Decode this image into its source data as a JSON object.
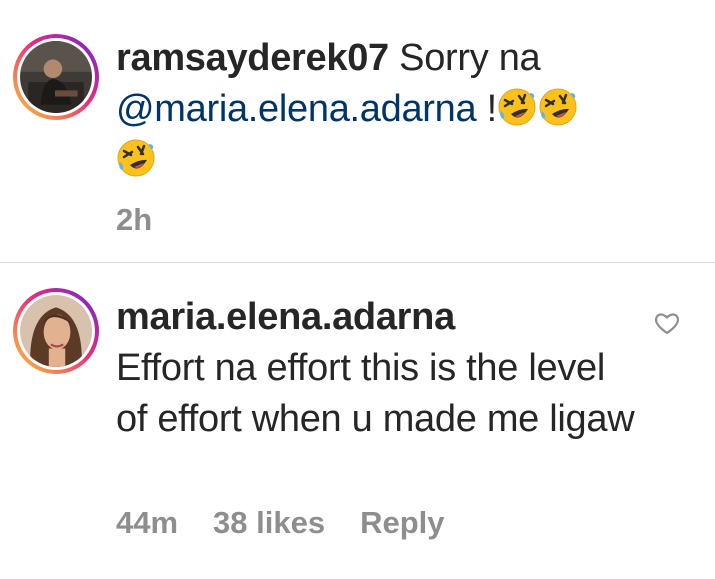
{
  "comments": [
    {
      "username": "ramsayderek07",
      "text_before": "Sorry na",
      "mention": "@maria.elena.adarna",
      "text_after": "!",
      "emojis": [
        "rolling-on-floor-laughing",
        "rolling-on-floor-laughing",
        "rolling-on-floor-laughing"
      ],
      "time": "2h",
      "avatar": "male-user-avatar"
    },
    {
      "username": "maria.elena.adarna",
      "text": "Effort na effort this is the level of effort when u made me ligaw",
      "time": "44m",
      "likes": "38 likes",
      "reply_label": "Reply",
      "avatar": "female-user-avatar",
      "like_icon": "heart-outline-icon"
    }
  ],
  "colors": {
    "mention": "#003569",
    "meta_text": "#8e8e8e",
    "divider": "#dbdbdb",
    "story_ring": [
      "#f9ce34",
      "#ee2a7b",
      "#6228d7"
    ]
  }
}
